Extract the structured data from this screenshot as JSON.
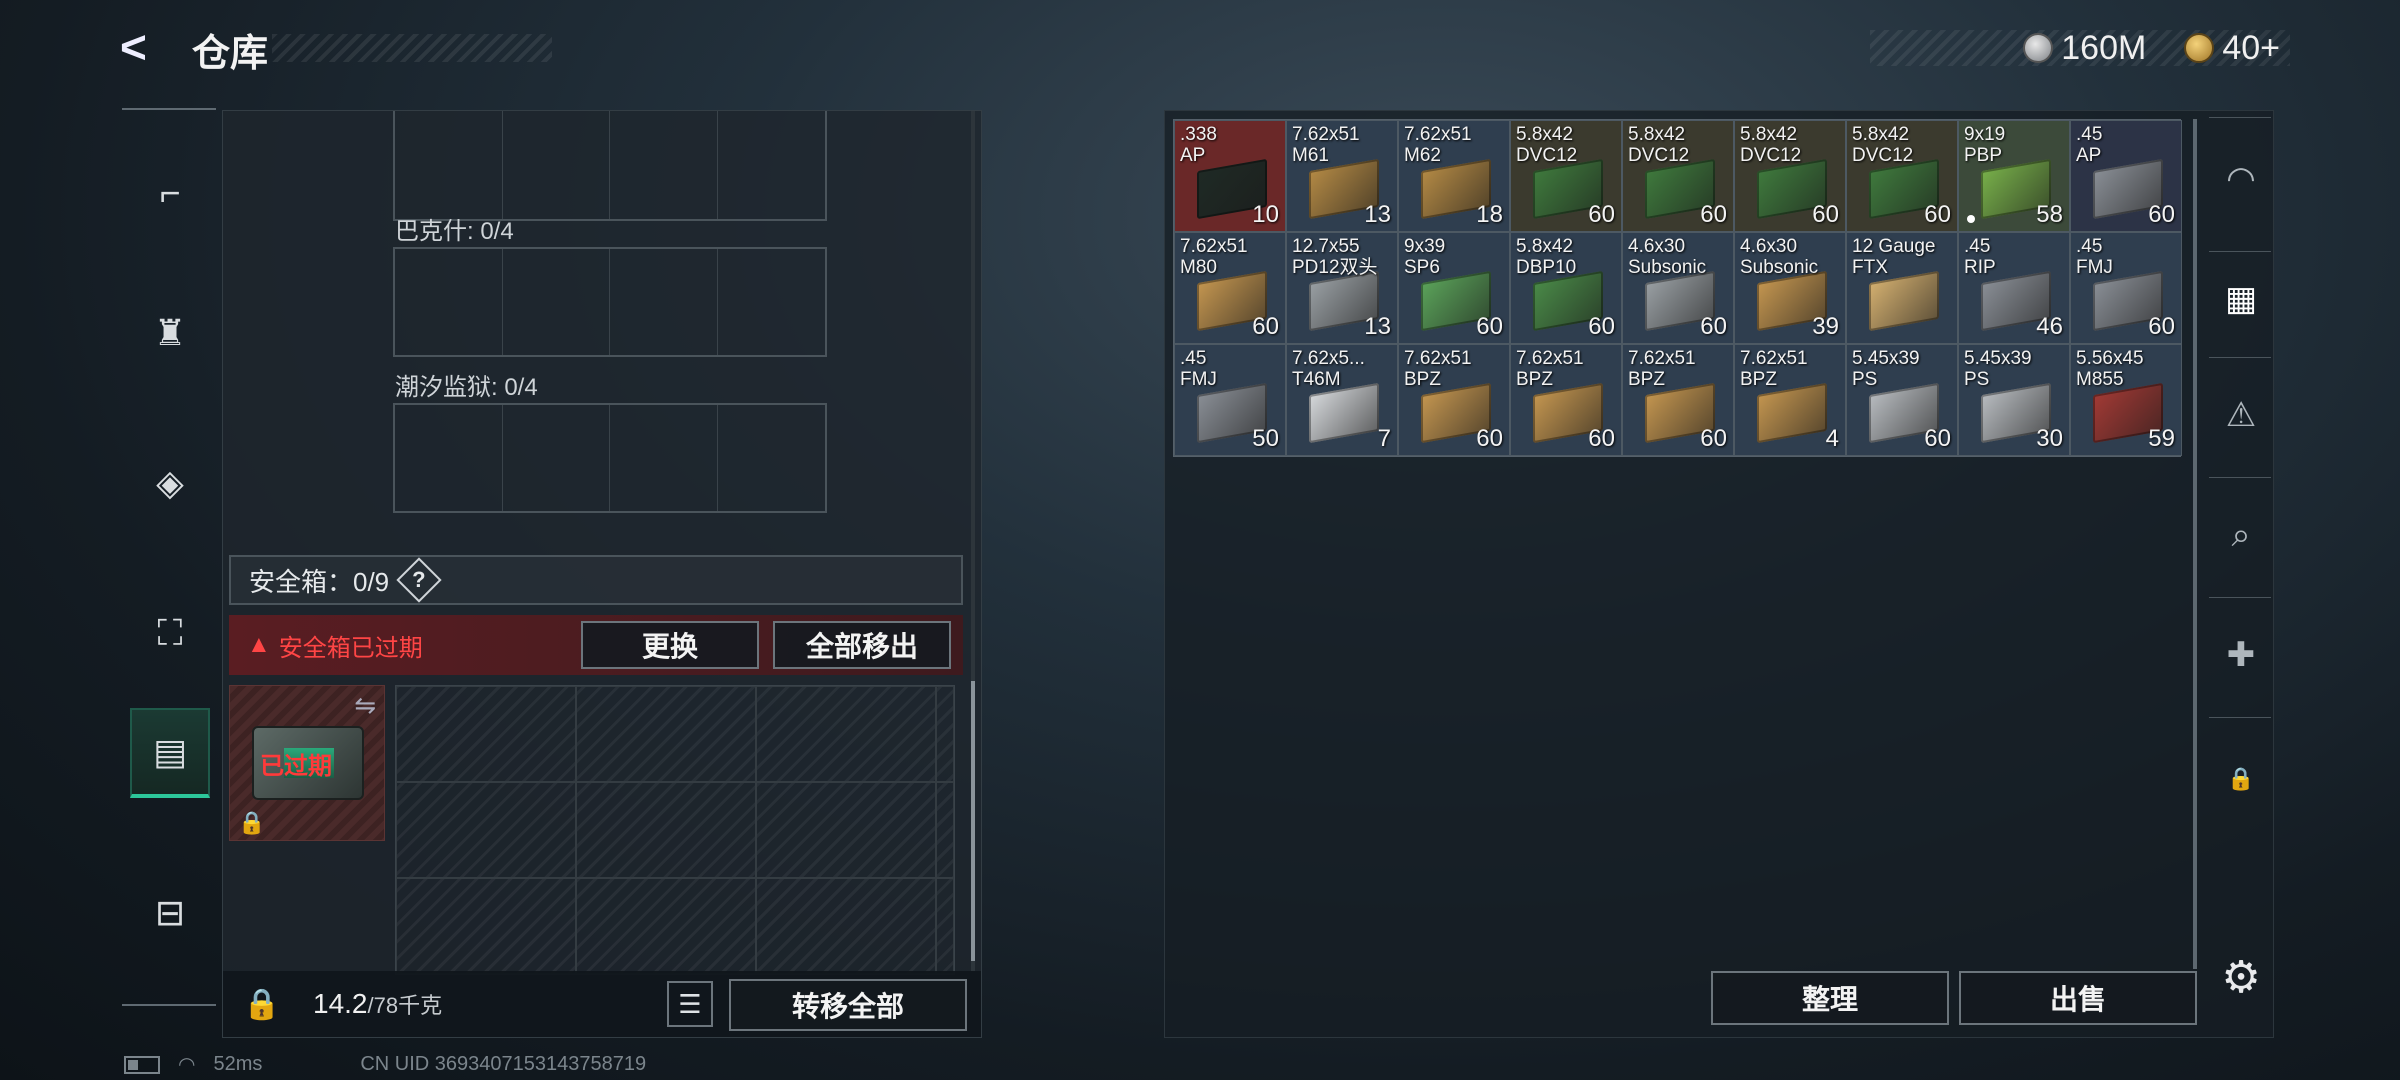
{
  "header": {
    "back_glyph": "<",
    "title": "仓库",
    "currencies": [
      {
        "icon": "silver-coin-icon",
        "value": "160M"
      },
      {
        "icon": "gold-coin-icon",
        "value": "40+"
      }
    ]
  },
  "left_rail": {
    "items": [
      {
        "name": "weapon",
        "icon": "gun-icon",
        "glyph": "⌐"
      },
      {
        "name": "armor",
        "icon": "vest-icon",
        "glyph": "♜"
      },
      {
        "name": "rig",
        "icon": "rig-icon",
        "glyph": "◈"
      },
      {
        "name": "backpack",
        "icon": "backpack-icon",
        "glyph": "⛶"
      },
      {
        "name": "safe-box",
        "icon": "safe-icon",
        "glyph": "▤",
        "active": true
      },
      {
        "name": "toolbox",
        "icon": "toolbox-icon",
        "glyph": "⊟"
      }
    ]
  },
  "left_panel": {
    "containers": [
      {
        "label": ""
      },
      {
        "label": "巴克什: 0/4"
      },
      {
        "label": "潮汐监狱: 0/4"
      }
    ],
    "safe": {
      "label": "安全箱：0/9",
      "help": "?",
      "expired_text": "安全箱已过期",
      "replace_button": "更换",
      "move_all_out_button": "全部移出",
      "slot_expired_text": "已过期"
    },
    "footer": {
      "weight_value": "14.2",
      "weight_capacity": "/78千克",
      "transfer_all_button": "转移全部"
    }
  },
  "ammo_items": [
    {
      "name": ".338\nAP",
      "count": "10",
      "bg": "#6a2828",
      "box": "#1f2a25"
    },
    {
      "name": "7.62x51\nM61",
      "count": "13",
      "bg": "#2f3e4f",
      "box": "#b48a45"
    },
    {
      "name": "7.62x51\nM62",
      "count": "18",
      "bg": "#2f3e4f",
      "box": "#b48a45"
    },
    {
      "name": "5.8x42\nDVC12",
      "count": "60",
      "bg": "#3b3a2e",
      "box": "#3f7a3d"
    },
    {
      "name": "5.8x42\nDVC12",
      "count": "60",
      "bg": "#3b3a2e",
      "box": "#3f7a3d"
    },
    {
      "name": "5.8x42\nDVC12",
      "count": "60",
      "bg": "#3b3a2e",
      "box": "#3f7a3d"
    },
    {
      "name": "5.8x42\nDVC12",
      "count": "60",
      "bg": "#3b3a2e",
      "box": "#3f7a3d"
    },
    {
      "name": "9x19\nPBP",
      "count": "58",
      "bg": "#3c4a3a",
      "box": "#78b04a",
      "dot": true
    },
    {
      "name": ".45\nAP",
      "count": "60",
      "bg": "#2c3346",
      "box": "#8a8f96"
    },
    {
      "name": "7.62x51\nM80",
      "count": "60",
      "bg": "#2f3e4f",
      "box": "#c49650"
    },
    {
      "name": "12.7x55\nPD12双头",
      "count": "13",
      "bg": "#2f3e4f",
      "box": "#9aa0a4"
    },
    {
      "name": "9x39\nSP6",
      "count": "60",
      "bg": "#2f3e4f",
      "box": "#5ba35a"
    },
    {
      "name": "5.8x42\nDBP10",
      "count": "60",
      "bg": "#2f3e4f",
      "box": "#4a8a48"
    },
    {
      "name": "4.6x30\nSubsonic",
      "count": "60",
      "bg": "#2f3e4f",
      "box": "#9aa0a4"
    },
    {
      "name": "4.6x30\nSubsonic",
      "count": "39",
      "bg": "#2f3e4f",
      "box": "#c49650"
    },
    {
      "name": "12 Gauge\nFTX",
      "count": "",
      "bg": "#2f3e4f",
      "box": "#d4b070"
    },
    {
      "name": ".45\nRIP",
      "count": "46",
      "bg": "#2f3e4f",
      "box": "#8a8f96"
    },
    {
      "name": ".45\nFMJ",
      "count": "60",
      "bg": "#2f3e4f",
      "box": "#8a8f96"
    },
    {
      "name": ".45\nFMJ",
      "count": "50",
      "bg": "#2f3e4f",
      "box": "#8a8f96"
    },
    {
      "name": "7.62x5...\nT46M",
      "count": "7",
      "bg": "#2f3e4f",
      "box": "#d6d9dc"
    },
    {
      "name": "7.62x51\nBPZ",
      "count": "60",
      "bg": "#2f3e4f",
      "box": "#c49650"
    },
    {
      "name": "7.62x51\nBPZ",
      "count": "60",
      "bg": "#2f3e4f",
      "box": "#c49650"
    },
    {
      "name": "7.62x51\nBPZ",
      "count": "60",
      "bg": "#2f3e4f",
      "box": "#c49650"
    },
    {
      "name": "7.62x51\nBPZ",
      "count": "4",
      "bg": "#2f3e4f",
      "box": "#c49650"
    },
    {
      "name": "5.45x39\nPS",
      "count": "60",
      "bg": "#2f3e4f",
      "box": "#b8bcc0"
    },
    {
      "name": "5.45x39\nPS",
      "count": "30",
      "bg": "#2f3e4f",
      "box": "#b8bcc0"
    },
    {
      "name": "5.56x45\nM855",
      "count": "59",
      "bg": "#2f3e4f",
      "box": "#a23a35"
    }
  ],
  "right_rail": {
    "items": [
      {
        "name": "helmet",
        "icon": "helmet-icon",
        "glyph": "◠"
      },
      {
        "name": "storage",
        "icon": "storage-icon",
        "glyph": "▦"
      },
      {
        "name": "collection-1",
        "icon": "collection-icon",
        "glyph": "⚠"
      },
      {
        "name": "collection-v",
        "icon": "v-box-icon",
        "glyph": "⌕"
      },
      {
        "name": "collection-2",
        "icon": "medkit-box-icon",
        "glyph": "✚"
      },
      {
        "name": "locked",
        "icon": "lock-icon",
        "glyph": "🔒"
      }
    ],
    "settings_glyph": "⚙"
  },
  "right_footer": {
    "sort_button": "整理",
    "sell_button": "出售"
  },
  "status_bar": {
    "ping": "52ms",
    "uid": "CN UID 3693407153143758719"
  }
}
